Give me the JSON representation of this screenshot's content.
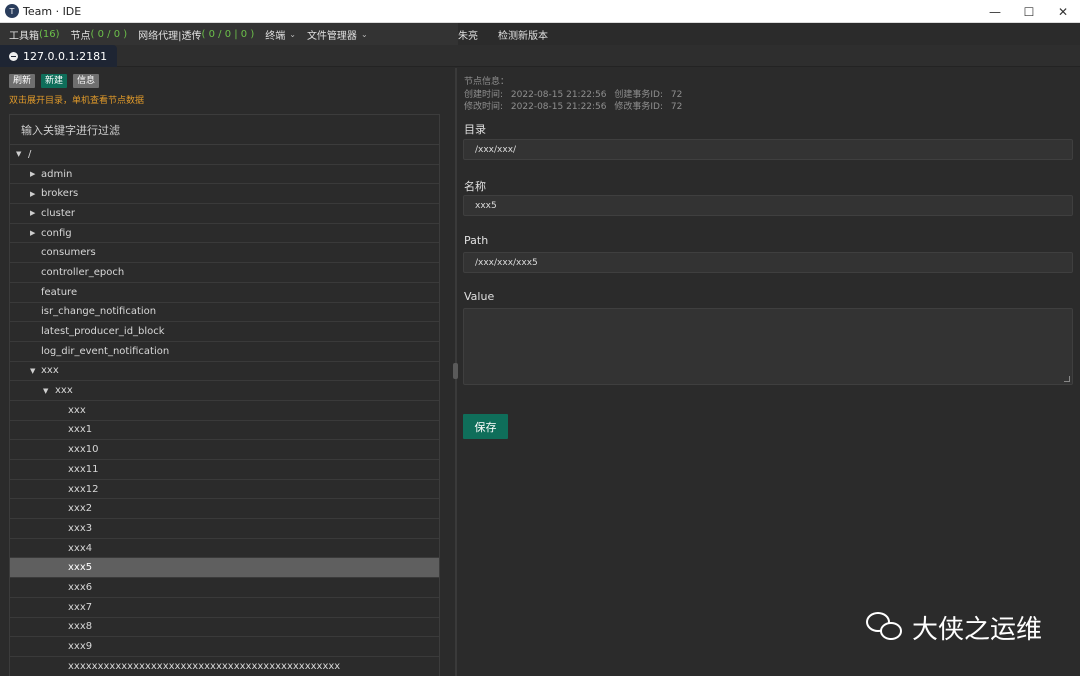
{
  "window": {
    "title": "Team · IDE"
  },
  "menu": {
    "toolbox_label": "工具箱",
    "toolbox_count": "(16)",
    "nodes_label": "节点",
    "nodes_count": "( 0 / 0 )",
    "proxy_label": "网络代理|透传",
    "proxy_count": "( 0 / 0 | 0 )",
    "terminal_label": "终端",
    "filemanager_label": "文件管理器",
    "user": "朱亮",
    "check_update": "检测新版本"
  },
  "tab": {
    "label": "127.0.0.1:2181"
  },
  "left": {
    "buttons": {
      "refresh": "刷新",
      "new": "新建",
      "info": "信息"
    },
    "hint": "双击展开目录，单机查看节点数据",
    "filter_placeholder": "输入关键字进行过滤"
  },
  "tree": {
    "root": "/",
    "items": [
      {
        "label": "admin"
      },
      {
        "label": "brokers"
      },
      {
        "label": "cluster"
      },
      {
        "label": "config"
      },
      {
        "label": "consumers"
      },
      {
        "label": "controller_epoch"
      },
      {
        "label": "feature"
      },
      {
        "label": "isr_change_notification"
      },
      {
        "label": "latest_producer_id_block"
      },
      {
        "label": "log_dir_event_notification"
      },
      {
        "label": "xxx"
      },
      {
        "label": "xxx"
      },
      {
        "label": "xxx"
      },
      {
        "label": "xxx1"
      },
      {
        "label": "xxx10"
      },
      {
        "label": "xxx11"
      },
      {
        "label": "xxx12"
      },
      {
        "label": "xxx2"
      },
      {
        "label": "xxx3"
      },
      {
        "label": "xxx4"
      },
      {
        "label": "xxx5"
      },
      {
        "label": "xxx6"
      },
      {
        "label": "xxx7"
      },
      {
        "label": "xxx8"
      },
      {
        "label": "xxx9"
      },
      {
        "label": "xxxxxxxxxxxxxxxxxxxxxxxxxxxxxxxxxxxxxxxxxxxxxx"
      }
    ]
  },
  "node_info": {
    "header": "节点信息：",
    "created_label": "创建时间:",
    "created_value": "2022-08-15 21:22:56",
    "create_txid_label": "创建事务ID:",
    "create_txid_value": "72",
    "modified_label": "修改时间:",
    "modified_value": "2022-08-15 21:22:56",
    "modify_txid_label": "修改事务ID:",
    "modify_txid_value": "72"
  },
  "form": {
    "dir_label": "目录",
    "dir_value": "/xxx/xxx/",
    "name_label": "名称",
    "name_value": "xxx5",
    "path_label": "Path",
    "path_value": "/xxx/xxx/xxx5",
    "value_label": "Value",
    "value_value": "",
    "save_label": "保存"
  },
  "watermark": {
    "text": "大侠之运维"
  }
}
